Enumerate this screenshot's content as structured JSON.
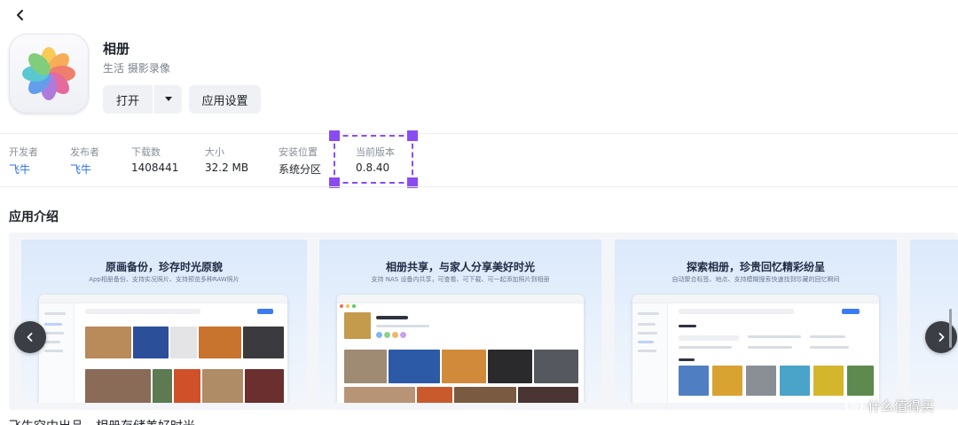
{
  "app": {
    "name": "相册",
    "category": "生活 摄影录像"
  },
  "actions": {
    "open_label": "打开",
    "settings_label": "应用设置"
  },
  "meta": [
    {
      "label": "开发者",
      "value": "飞牛",
      "link": true
    },
    {
      "label": "发布者",
      "value": "飞牛",
      "link": true
    },
    {
      "label": "下载数",
      "value": "1408441",
      "link": false
    },
    {
      "label": "大小",
      "value": "32.2 MB",
      "link": false
    },
    {
      "label": "安装位置",
      "value": "系统分区",
      "link": false
    },
    {
      "label": "当前版本",
      "value": "0.8.40",
      "link": false
    }
  ],
  "intro": {
    "title": "应用介绍",
    "slides": [
      {
        "title": "原画备份，珍存时光原貌",
        "subtitle": "App相册备份、支持实况照片、支持预览多种RAW照片"
      },
      {
        "title": "相册共享，与家人分享美好时光",
        "subtitle": "支持 NAS 设备内共享，可查看、可下载、可一起添加照片到相册"
      },
      {
        "title": "探索相册，珍贵回忆精彩纷呈",
        "subtitle": "自动聚合标签、地点、支持模糊搜索快速找到珍藏的回忆瞬间"
      }
    ]
  },
  "truncated_text": "飞牛空中出品，相册存储美好时光",
  "watermark": "什么值得买",
  "colors": {
    "accent": "#2a6df4",
    "highlight": "#8a4cf2"
  },
  "icons": {
    "back": "chevron-left-icon",
    "app": "flower-petals-icon",
    "dropdown": "caret-down-icon",
    "prev": "chevron-left-icon",
    "next": "chevron-right-icon"
  }
}
